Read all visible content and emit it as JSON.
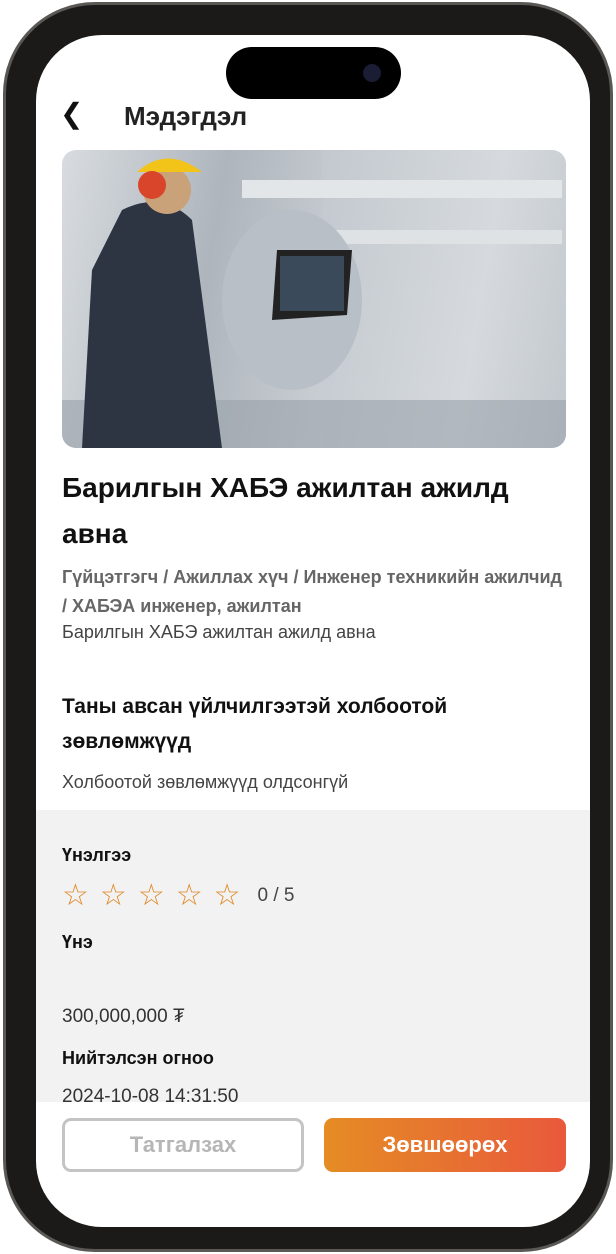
{
  "header": {
    "back_icon": "chevron-left-icon",
    "title": "Мэдэгдэл"
  },
  "post": {
    "title": "Барилгын ХАБЭ ажилтан ажилд авна",
    "category": "Гүйцэтгэгч / Ажиллах хүч / Инженер техникийн ажилчид / ХАБЭА инженер, ажилтан",
    "description": "Барилгын ХАБЭ ажилтан ажилд авна"
  },
  "related": {
    "heading": "Таны авсан үйлчилгээтэй холбоотой зөвлөмжүүд",
    "empty": "Холбоотой зөвлөмжүүд олдсонгүй"
  },
  "details": {
    "rating_label": "Үнэлгээ",
    "rating_value": 0,
    "rating_max": 5,
    "rating_text": "0 / 5",
    "price_label": "Үнэ",
    "price": "300,000,000 ₮",
    "date_label": "Нийтэлсэн огноо",
    "date": "2024-10-08 14:31:50"
  },
  "actions": {
    "decline": "Татгалзах",
    "accept": "Зөвшөөрөх"
  },
  "colors": {
    "accent_start": "#e58c24",
    "accent_end": "#e9593c",
    "star": "#e0892a"
  }
}
